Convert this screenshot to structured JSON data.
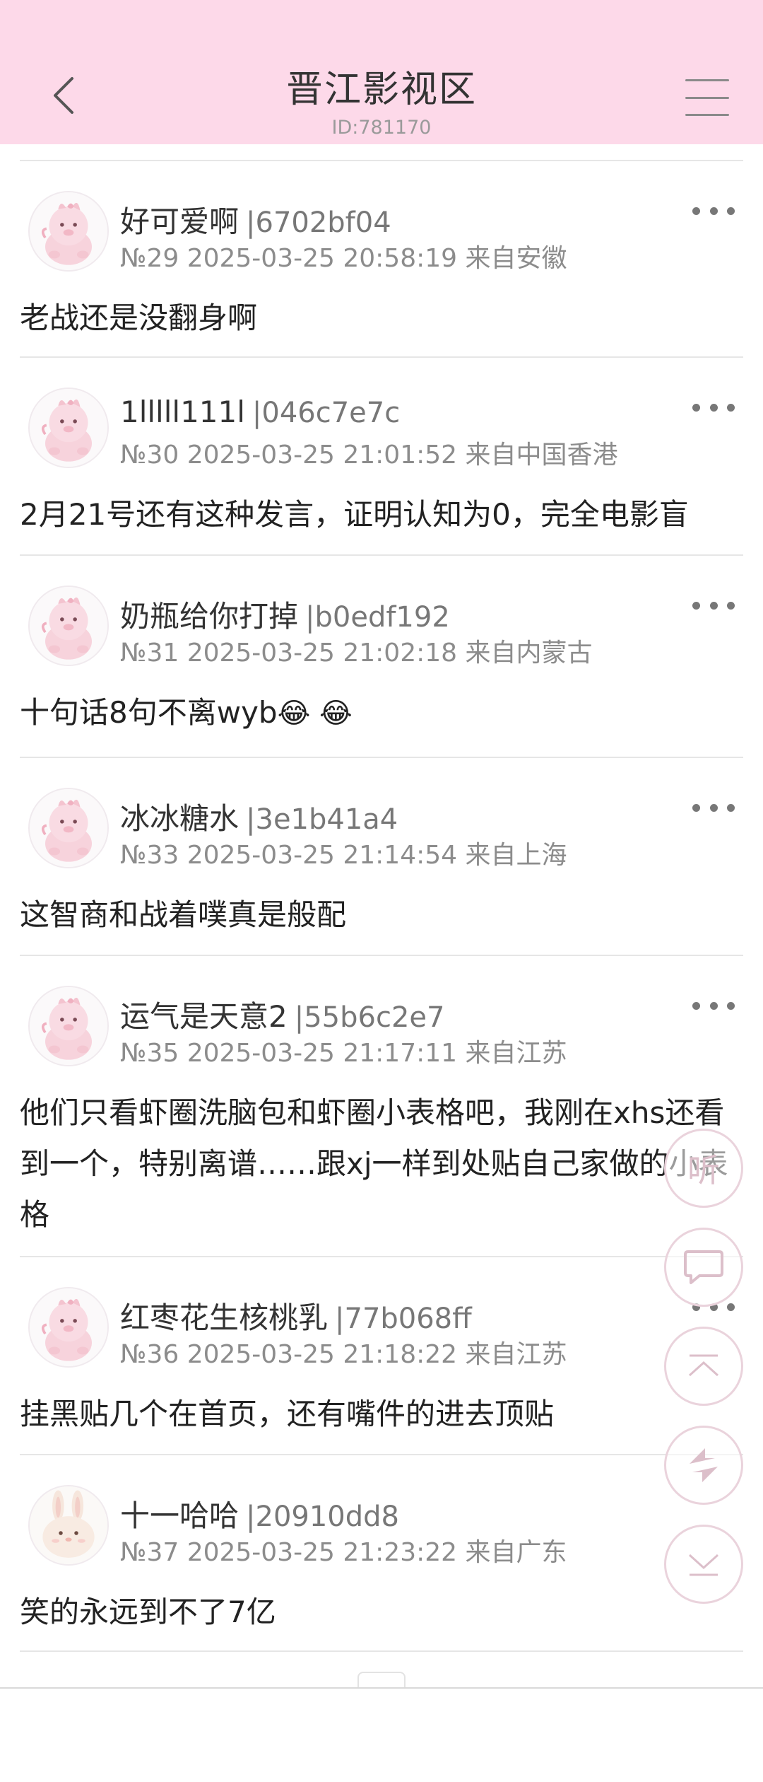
{
  "header": {
    "title": "晋江影视区",
    "subtitle": "ID:781170",
    "background": "#fdd9e9"
  },
  "posts": [
    {
      "name": "好可爱啊",
      "uid": "|6702bf04",
      "meta": "№29 2025-03-25 20:58:19 来自安徽",
      "content": "老战还是没翻身啊",
      "avatar": "pink-pig-icon"
    },
    {
      "name": "1lllll111l",
      "uid": "|046c7e7c",
      "meta": "№30 2025-03-25 21:01:52 来自中国香港",
      "content": "2月21号还有这种发言，证明认知为0，完全电影盲",
      "avatar": "pink-pig-icon"
    },
    {
      "name": "奶瓶给你打掉",
      "uid": "|b0edf192",
      "meta": "№31 2025-03-25 21:02:18 来自内蒙古",
      "content": "十句话8句不离wyb",
      "emojis": "😂 😂",
      "avatar": "pink-pig-icon"
    },
    {
      "name": "冰冰糖水",
      "uid": "|3e1b41a4",
      "meta": "№33 2025-03-25 21:14:54 来自上海",
      "content": "这智商和战着噗真是般配",
      "avatar": "pink-pig-icon"
    },
    {
      "name": "运气是天意2",
      "uid": "|55b6c2e7",
      "meta": "№35 2025-03-25 21:17:11 来自江苏",
      "content": "他们只看虾圈洗脑包和虾圈小表格吧，我刚在xhs还看到一个，特别离谱……跟xj一样到处贴自己家做的小表格",
      "avatar": "pink-pig-icon"
    },
    {
      "name": "红枣花生核桃乳",
      "uid": "|77b068ff",
      "meta": "№36 2025-03-25 21:18:22 来自江苏",
      "content": "挂黑贴几个在首页，还有嘴件的进去顶贴",
      "avatar": "pink-pig-icon"
    },
    {
      "name": "十一哈哈",
      "uid": "|20910dd8",
      "meta": "№37 2025-03-25 21:23:22 来自广东",
      "content": "笑的永远到不了7亿",
      "avatar": "bunny-icon"
    }
  ],
  "floating_buttons": {
    "listen_label": "听",
    "comment": "comment-icon",
    "top": "scroll-top-icon",
    "refresh": "refresh-icon",
    "bottom": "scroll-bottom-icon"
  }
}
